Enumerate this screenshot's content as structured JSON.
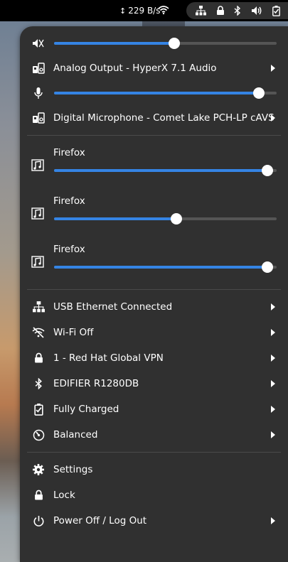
{
  "topbar": {
    "net_speed": "229 B/s"
  },
  "audio": {
    "output_volume": 0.54,
    "output_device": "Analog Output - HyperX 7.1 Audio",
    "input_volume": 0.92,
    "input_device": "Digital Microphone - Comet Lake PCH-LP cAVS"
  },
  "apps": [
    {
      "name": "Firefox",
      "volume": 0.96
    },
    {
      "name": "Firefox",
      "volume": 0.55
    },
    {
      "name": "Firefox",
      "volume": 0.96
    }
  ],
  "network": {
    "ethernet": "USB Ethernet Connected",
    "wifi": "Wi-Fi Off",
    "vpn": "1 - Red Hat Global VPN",
    "bluetooth": "EDIFIER R1280DB",
    "battery": "Fully Charged",
    "power_mode": "Balanced"
  },
  "system": {
    "settings": "Settings",
    "lock": "Lock",
    "power": "Power Off / Log Out"
  },
  "colors": {
    "accent": "#3584e4",
    "menu_bg": "#303030",
    "topbar_bg": "#000000"
  }
}
